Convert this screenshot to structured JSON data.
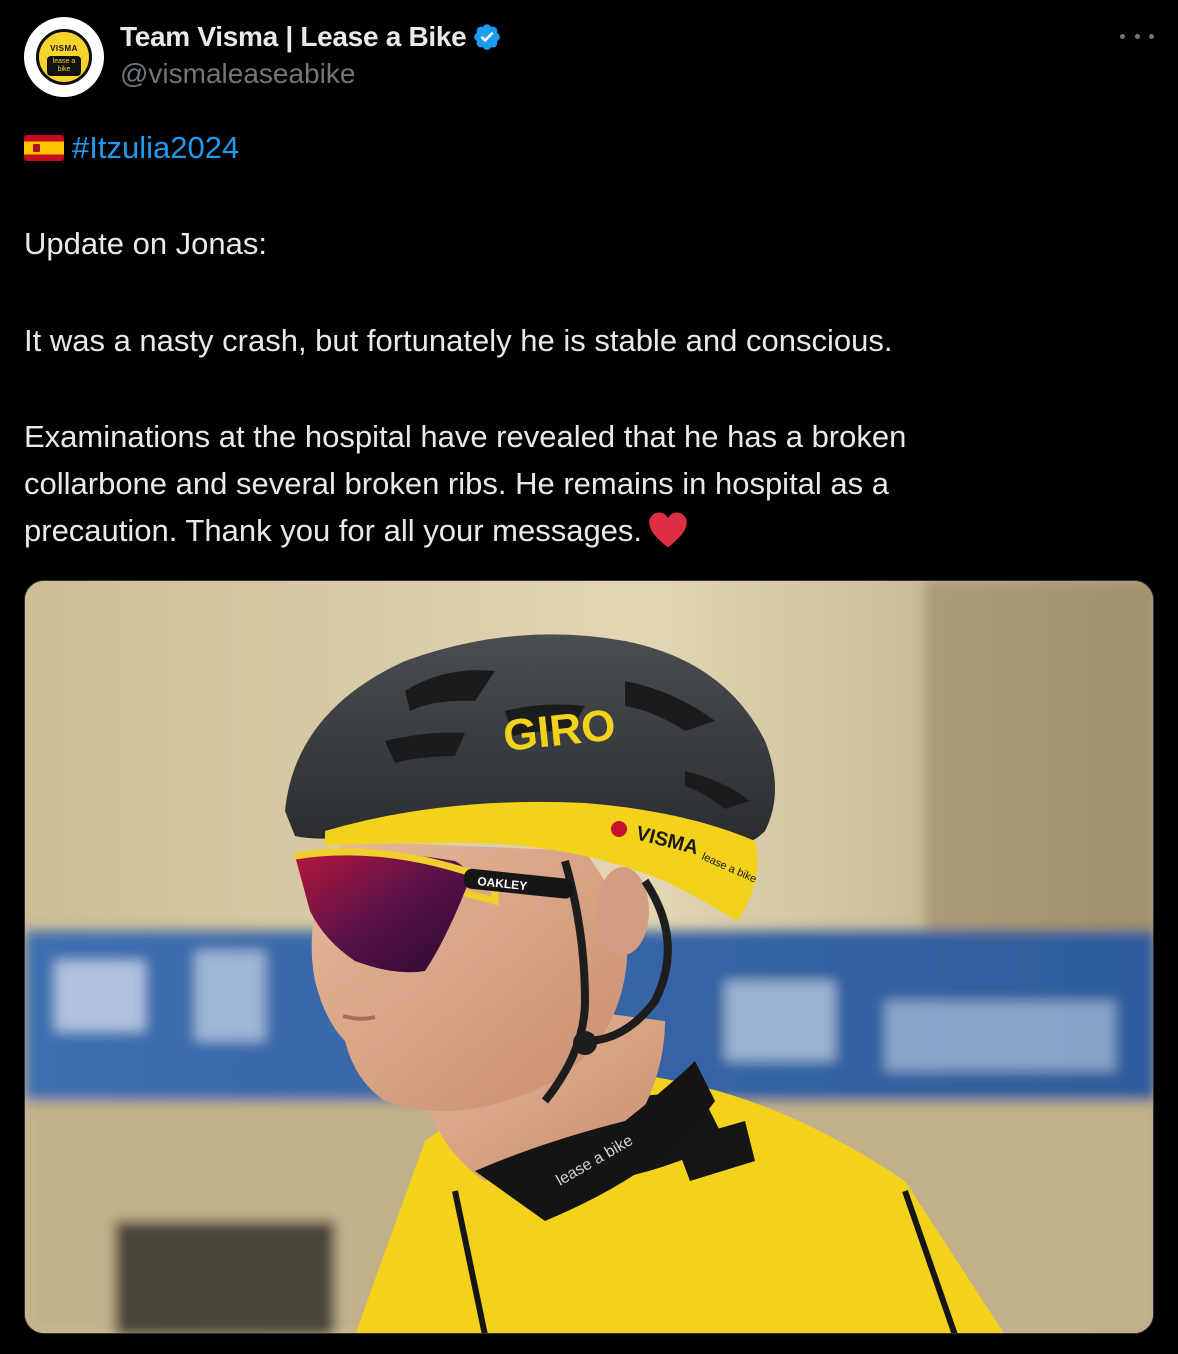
{
  "author": {
    "display_name": "Team Visma | Lease a Bike",
    "handle": "@vismaleaseabike",
    "verified": true,
    "avatar": {
      "top_text": "VISMA",
      "bottom_text": "lease a bike"
    }
  },
  "menu": {
    "icon": "more-dots-icon"
  },
  "tweet": {
    "flag_icon": "spain-flag-icon",
    "hashtag": "#Itzulia2024",
    "paragraphs": [
      "Update on Jonas:",
      "It was a nasty crash, but fortunately he is stable and conscious.",
      "Examinations at the hospital have revealed that he has a broken collarbone and several broken ribs. He remains in hospital as a precaution. Thank you for all your messages."
    ],
    "trailing_emoji": "red-heart-icon"
  },
  "media": {
    "helmet_brand": "GIRO",
    "helmet_sponsor": "VISMA",
    "helmet_sponsor_sub": "lease a bike",
    "glasses_brand": "OAKLEY",
    "collar_text": "lease a bike"
  },
  "colors": {
    "background": "#000000",
    "text": "#e7e9ea",
    "secondary": "#71767b",
    "link": "#1d9bf0",
    "verified": "#1d9bf0",
    "team_yellow": "#f5d42b"
  }
}
